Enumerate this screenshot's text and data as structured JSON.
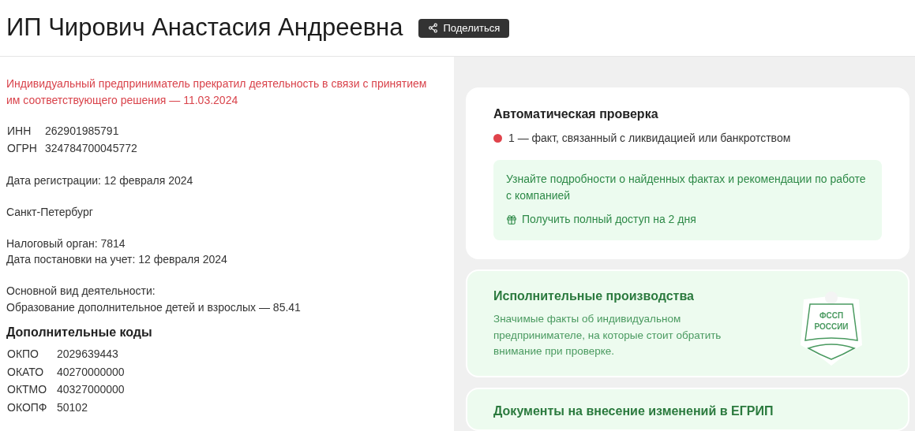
{
  "header": {
    "title": "ИП Чирович Анастасия Андреевна",
    "share_button": "Поделиться"
  },
  "status_notice": "Индивидуальный предприниматель прекратил деятельность в связи с принятием им соответствующего решения — 11.03.2024",
  "ids": [
    {
      "label": "ИНН",
      "value": "262901985791"
    },
    {
      "label": "ОГРН",
      "value": "324784700045772"
    }
  ],
  "registration_date": "Дата регистрации: 12 февраля 2024",
  "city": "Санкт-Петербург",
  "tax": [
    "Налоговый орган: 7814",
    "Дата постановки на учет: 12 февраля 2024"
  ],
  "activity": [
    "Основной вид деятельности:",
    "Образование дополнительное детей и взрослых — 85.41"
  ],
  "extra_codes": {
    "title": "Дополнительные коды",
    "rows": [
      {
        "label": "ОКПО",
        "value": "2029639443"
      },
      {
        "label": "ОКАТО",
        "value": "40270000000"
      },
      {
        "label": "ОКТМО",
        "value": "40327000000"
      },
      {
        "label": "ОКОПФ",
        "value": "50102"
      }
    ]
  },
  "auto_check": {
    "title": "Автоматическая проверка",
    "facts": [
      {
        "text": "1 — факт, связанный с ликвидацией или банкротством",
        "color": "#e0434b"
      }
    ],
    "promo": {
      "text": "Узнайте подробности о найденных фактах и рекомендации по работе с компанией",
      "link": "Получить полный доступ на 2 дня"
    }
  },
  "enforcement": {
    "title": "Исполнительные производства",
    "text": "Значимые факты об индивидуальном предпринимателе, на которые стоит обратить внимание при проверке.",
    "emblem": [
      "ФССП",
      "РОССИИ"
    ]
  },
  "documents": {
    "title": "Документы на внесение изменений в ЕГРИП"
  }
}
